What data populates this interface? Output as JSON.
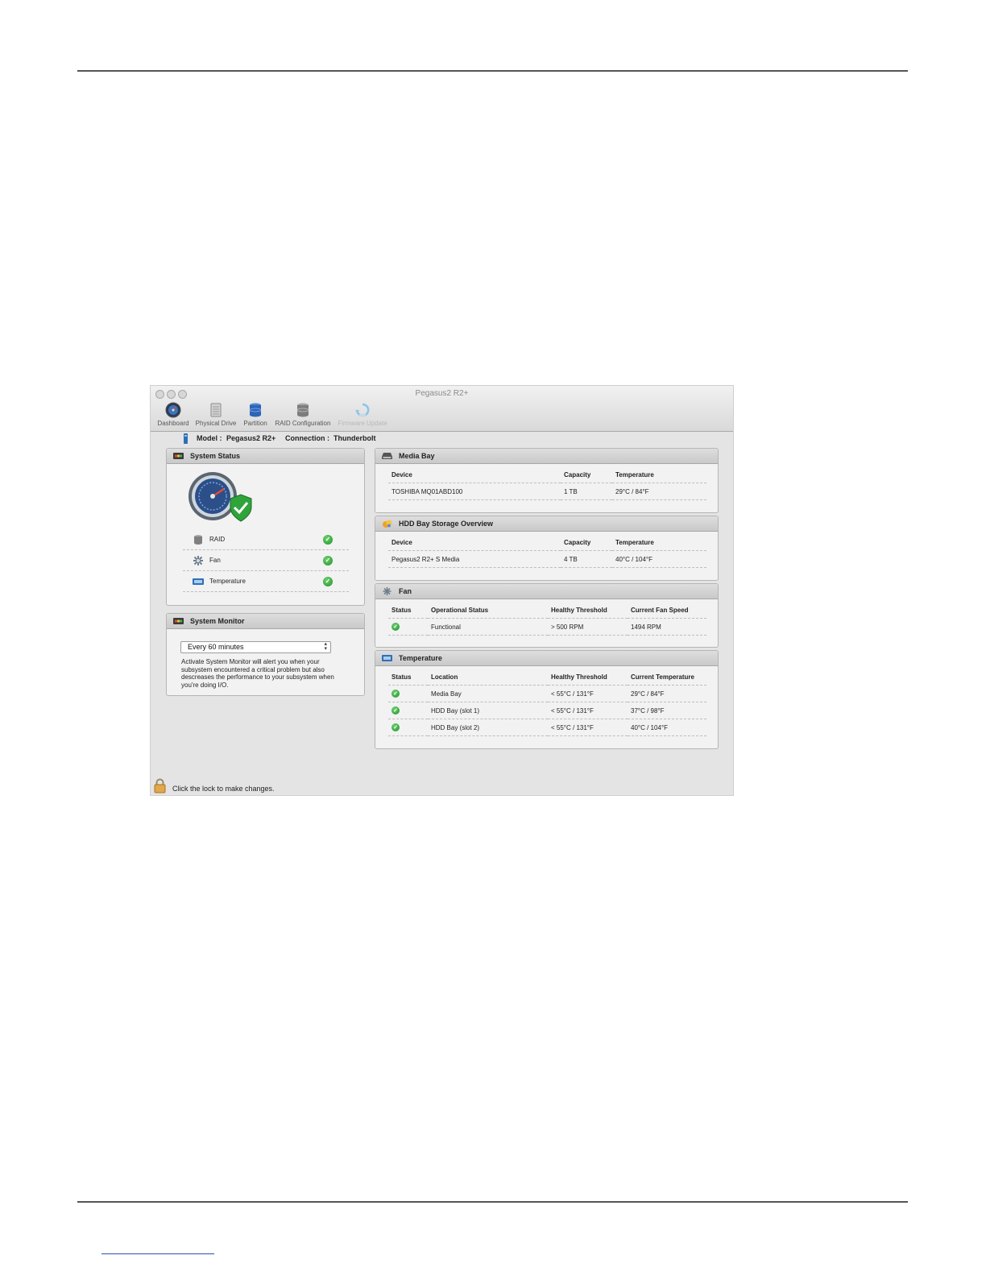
{
  "window": {
    "title": "Pegasus2 R2+",
    "toolbar": [
      {
        "label": "Dashboard",
        "icon": "dashboard-gauge-icon",
        "enabled": true
      },
      {
        "label": "Physical Drive",
        "icon": "physical-drive-icon",
        "enabled": true
      },
      {
        "label": "Partition",
        "icon": "partition-icon",
        "enabled": true
      },
      {
        "label": "RAID Configuration",
        "icon": "raid-configuration-icon",
        "enabled": true
      },
      {
        "label": "Firmware Update",
        "icon": "firmware-update-icon",
        "enabled": false
      }
    ]
  },
  "model_bar": {
    "model_label": "Model :",
    "model_value": "Pegasus2 R2+",
    "connection_label": "Connection :",
    "connection_value": "Thunderbolt"
  },
  "system_status": {
    "title": "System Status",
    "items": [
      {
        "label": "RAID",
        "icon": "raid-disk-icon",
        "status": "ok"
      },
      {
        "label": "Fan",
        "icon": "fan-icon",
        "status": "ok"
      },
      {
        "label": "Temperature",
        "icon": "thermometer-icon",
        "status": "ok"
      }
    ]
  },
  "system_monitor": {
    "title": "System Monitor",
    "selected_interval": "Every 60 minutes",
    "description": "Activate System Monitor will alert you when your subsystem encountered a critical problem but also descreases the performance to your subsystem when you're doing I/O."
  },
  "media_bay": {
    "title": "Media Bay",
    "columns": [
      "Device",
      "Capacity",
      "Temperature"
    ],
    "rows": [
      {
        "device": "TOSHIBA MQ01ABD100",
        "capacity": "1 TB",
        "temperature": "29°C / 84°F"
      }
    ]
  },
  "hdd_bay": {
    "title": "HDD Bay Storage Overview",
    "columns": [
      "Device",
      "Capacity",
      "Temperature"
    ],
    "rows": [
      {
        "device": "Pegasus2 R2+ S Media",
        "capacity": "4 TB",
        "temperature": "40°C / 104°F"
      }
    ]
  },
  "fan": {
    "title": "Fan",
    "columns": [
      "Status",
      "Operational Status",
      "Healthy Threshold",
      "Current Fan Speed"
    ],
    "rows": [
      {
        "status": "ok",
        "operational_status": "Functional",
        "healthy_threshold": "> 500 RPM",
        "current_speed": "1494 RPM"
      }
    ]
  },
  "temperature": {
    "title": "Temperature",
    "columns": [
      "Status",
      "Location",
      "Healthy Threshold",
      "Current Temperature"
    ],
    "rows": [
      {
        "status": "ok",
        "location": "Media Bay",
        "healthy_threshold": "< 55°C / 131°F",
        "current": "29°C / 84°F"
      },
      {
        "status": "ok",
        "location": "HDD Bay (slot 1)",
        "healthy_threshold": "< 55°C / 131°F",
        "current": "37°C / 98°F"
      },
      {
        "status": "ok",
        "location": "HDD Bay (slot 2)",
        "healthy_threshold": "< 55°C / 131°F",
        "current": "40°C / 104°F"
      }
    ]
  },
  "lock_bar": {
    "text": "Click the lock to make changes."
  },
  "colors": {
    "ok_green": "#1f8f2a",
    "window_bg": "#e4e4e4",
    "panel_bg": "#f2f2f2",
    "page_rule": "#555555",
    "footer_link": "#2d4fb6"
  }
}
